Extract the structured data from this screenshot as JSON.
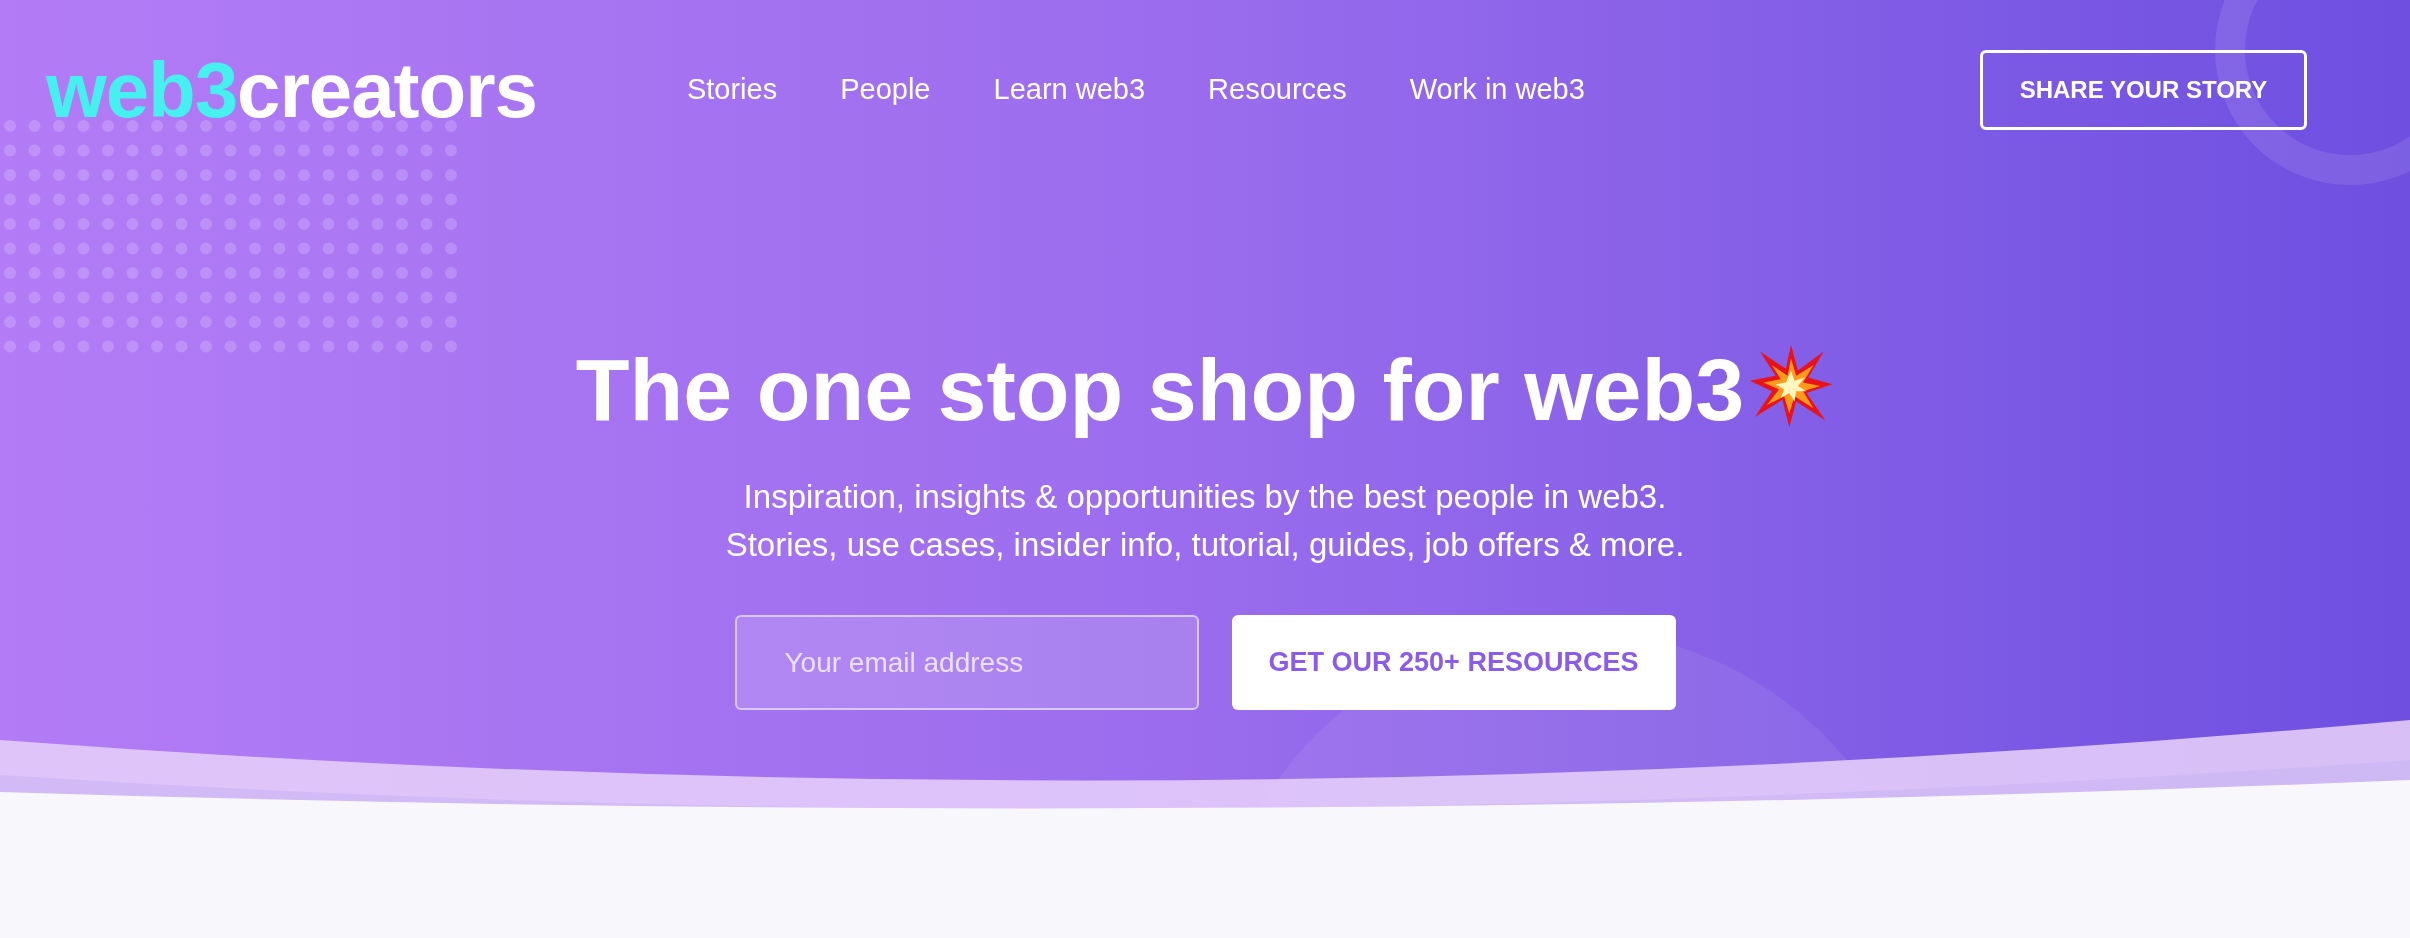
{
  "logo": {
    "accent": "web3",
    "text": "creators"
  },
  "nav": {
    "items": [
      {
        "label": "Stories"
      },
      {
        "label": "People"
      },
      {
        "label": "Learn web3"
      },
      {
        "label": "Resources"
      },
      {
        "label": "Work in web3"
      }
    ],
    "cta": "SHARE YOUR STORY"
  },
  "hero": {
    "title": "The one stop shop for web3",
    "subtitle": [
      "Inspiration, insights & opportunities by the best people in web3.",
      "Stories, use cases, insider info, tutorial, guides, job offers & more."
    ],
    "email": {
      "placeholder": "Your email address"
    },
    "button": "GET OUR 250+ RESOURCES"
  }
}
